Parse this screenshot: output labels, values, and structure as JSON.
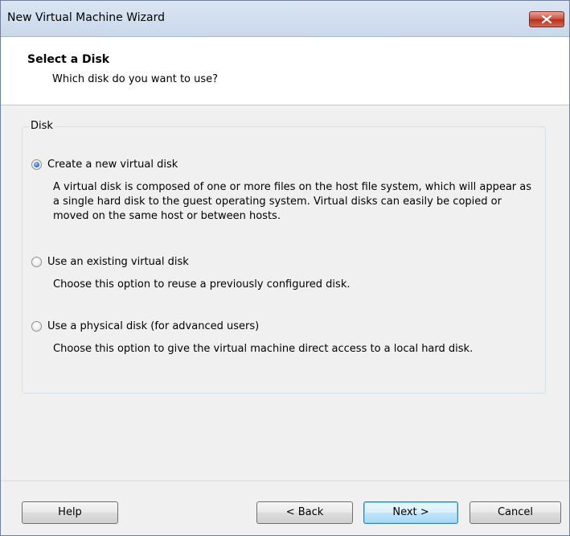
{
  "window": {
    "title": "New Virtual Machine Wizard"
  },
  "header": {
    "title": "Select a Disk",
    "subtitle": "Which disk do you want to use?"
  },
  "disk_group": {
    "legend": "Disk",
    "options": [
      {
        "label": "Create a new virtual disk",
        "selected": true,
        "description": "A virtual disk is composed of one or more files on the host file system, which will appear as a single hard disk to the guest operating system. Virtual disks can easily be copied or moved on the same host or between hosts."
      },
      {
        "label": "Use an existing virtual disk",
        "selected": false,
        "description": "Choose this option to reuse a previously configured disk."
      },
      {
        "label": "Use a physical disk (for advanced users)",
        "selected": false,
        "description": "Choose this option to give the virtual machine direct access to a local hard disk."
      }
    ]
  },
  "buttons": {
    "help": "Help",
    "back": "< Back",
    "next": "Next >",
    "cancel": "Cancel"
  },
  "colors": {
    "close_button": "#c94d3c",
    "titlebar": "#d3e0ef",
    "default_button_border": "#3c7fb1"
  }
}
